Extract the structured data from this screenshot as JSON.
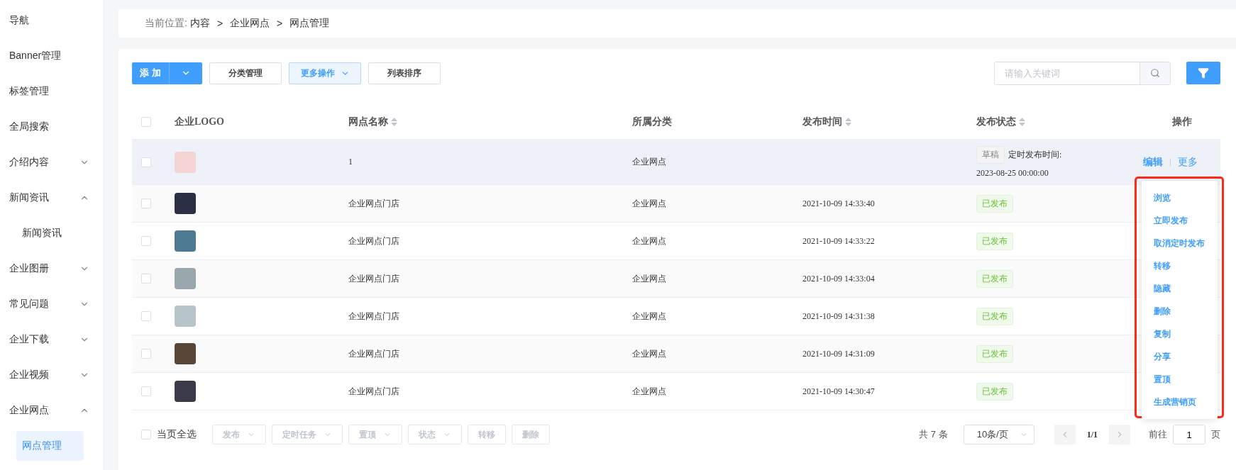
{
  "sidebar": {
    "items": [
      {
        "label": "导航",
        "selected": false
      },
      {
        "label": "Banner管理",
        "selected": false
      },
      {
        "label": "标签管理",
        "selected": false
      },
      {
        "label": "全局搜索",
        "selected": false
      },
      {
        "label": "介绍内容",
        "expanded": false,
        "selected": false
      },
      {
        "label": "新闻资讯",
        "expanded": true,
        "selected": false,
        "children": [
          {
            "label": "新闻资讯",
            "selected": false
          }
        ]
      },
      {
        "label": "企业图册",
        "expanded": false,
        "selected": false
      },
      {
        "label": "常见问题",
        "expanded": false,
        "selected": false
      },
      {
        "label": "企业下载",
        "expanded": false,
        "selected": false
      },
      {
        "label": "企业视频",
        "expanded": false,
        "selected": false
      },
      {
        "label": "企业网点",
        "expanded": true,
        "selected": false,
        "children": [
          {
            "label": "网点管理",
            "selected": true
          }
        ]
      }
    ]
  },
  "breadcrumb": {
    "prefix": "当前位置:",
    "items": [
      "内容",
      "企业网点",
      "网点管理"
    ],
    "separator": ">"
  },
  "toolbar": {
    "add": "添 加",
    "buttons": [
      {
        "label": "分类管理",
        "kind": "plain"
      },
      {
        "label": "更多操作",
        "kind": "menu"
      },
      {
        "label": "列表排序",
        "kind": "plain"
      }
    ],
    "search": {
      "placeholder": "请输入关键词"
    }
  },
  "table": {
    "select_all_checked": false,
    "columns": [
      {
        "label": "企业LOGO",
        "sortable": false
      },
      {
        "label": "网点名称",
        "sortable": true
      },
      {
        "label": "所属分类",
        "sortable": false
      },
      {
        "label": "发布时间",
        "sortable": true
      },
      {
        "label": "发布状态",
        "sortable": true
      },
      {
        "label": "操作",
        "sortable": false
      }
    ],
    "rows": [
      {
        "checked": false,
        "hover": true,
        "name": "1",
        "category": "企业网点",
        "status": {
          "label": "草稿",
          "kind": "draft"
        },
        "schedule": "定时发布时间:",
        "schedule_time": "2023-08-25 00:00:00",
        "actions": [
          "编辑",
          "更多"
        ]
      },
      {
        "checked": false,
        "hover": false,
        "name": "企业网点门店",
        "category": "企业网点",
        "time": "2021-10-09 14:33:40",
        "status": {
          "label": "已发布",
          "kind": "published"
        }
      },
      {
        "checked": false,
        "hover": false,
        "name": "企业网点门店",
        "category": "企业网点",
        "time": "2021-10-09 14:33:22",
        "status": {
          "label": "已发布",
          "kind": "published"
        }
      },
      {
        "checked": false,
        "hover": false,
        "name": "企业网点门店",
        "category": "企业网点",
        "time": "2021-10-09 14:33:04",
        "status": {
          "label": "已发布",
          "kind": "published"
        }
      },
      {
        "checked": false,
        "hover": false,
        "name": "企业网点门店",
        "category": "企业网点",
        "time": "2021-10-09 14:31:38",
        "status": {
          "label": "已发布",
          "kind": "published"
        }
      },
      {
        "checked": false,
        "hover": false,
        "name": "企业网点门店",
        "category": "企业网点",
        "time": "2021-10-09 14:31:09",
        "status": {
          "label": "已发布",
          "kind": "published"
        }
      },
      {
        "checked": false,
        "hover": false,
        "name": "企业网点门店",
        "category": "企业网点",
        "time": "2021-10-09 14:30:47",
        "status": {
          "label": "已发布",
          "kind": "published"
        }
      }
    ]
  },
  "more_menu": {
    "highlighted": true,
    "items": [
      "浏览",
      "立即发布",
      "取消定时发布",
      "转移",
      "隐藏",
      "删除",
      "复制",
      "分享",
      "置顶",
      "生成营销页"
    ]
  },
  "bulk_bar": {
    "select_all": {
      "label": "当页全选",
      "checked": false
    },
    "buttons": [
      {
        "label": "发布",
        "dropdown": true
      },
      {
        "label": "定时任务",
        "dropdown": true
      },
      {
        "label": "置顶",
        "dropdown": true
      },
      {
        "label": "状态",
        "dropdown": true
      },
      {
        "label": "转移",
        "dropdown": false
      },
      {
        "label": "删除",
        "dropdown": false
      }
    ]
  },
  "pagination": {
    "total": "共 7 条",
    "page_size": "10条/页",
    "page": "1/1",
    "goto": "前往",
    "goto_value": "1",
    "page_unit": "页"
  }
}
